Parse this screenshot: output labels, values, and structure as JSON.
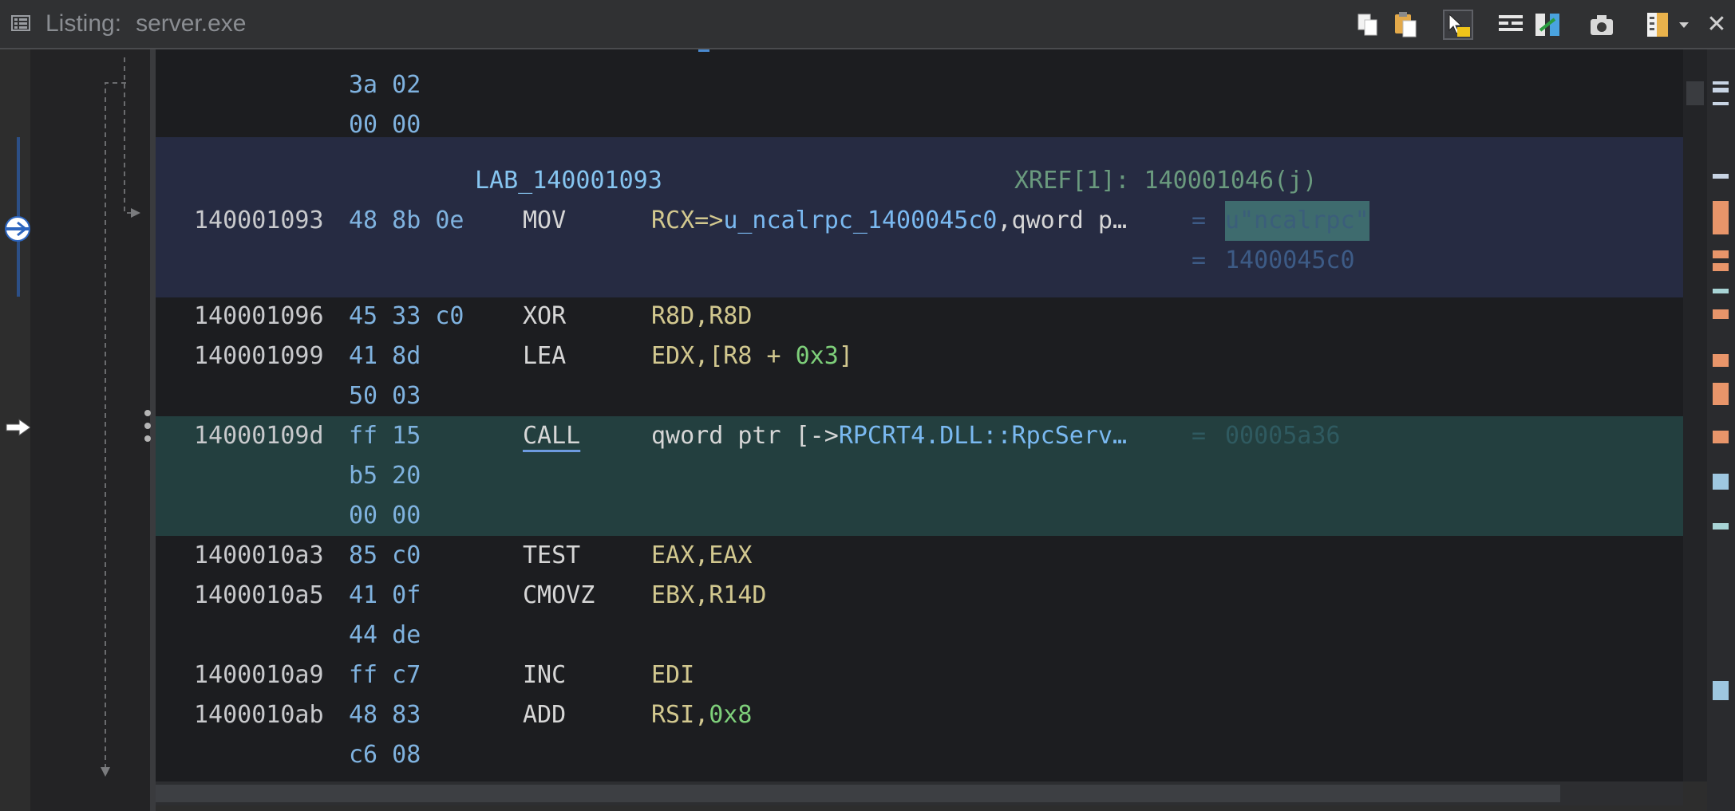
{
  "window": {
    "title_prefix": "Listing:",
    "title_file": "server.exe",
    "toolbar": [
      "copy-icon",
      "paste-icon",
      "cursor-highlight-icon",
      "field-config-icon",
      "diff-icon",
      "snapshot-icon",
      "display-options-icon",
      "dropdown-icon",
      "close-icon"
    ],
    "close_glyph": "✕"
  },
  "listing": {
    "rows": [
      {
        "bytes": "3a 02"
      },
      {
        "bytes": "00 00"
      },
      {
        "label": "LAB_140001093",
        "xref": "XREF[1]: 140001046(j)"
      },
      {
        "addr": "140001093",
        "bytes": "48 8b 0e",
        "mnemonic": "MOV",
        "op_pre": "RCX=>",
        "op_ref": "u_ncalrpc_1400045c0",
        "op_post": ",qword p…",
        "eq": " = ",
        "value": "u\"ncalrpc\""
      },
      {
        "eq": " = ",
        "value": "1400045c0"
      },
      {
        "addr": "140001096",
        "bytes": "45 33 c0",
        "mnemonic": "XOR",
        "operands": "R8D,R8D"
      },
      {
        "addr": "140001099",
        "bytes": "41 8d",
        "mnemonic": "LEA",
        "op_pre": "EDX,[R8 + ",
        "op_num": "0x3",
        "op_post": "]"
      },
      {
        "bytes": "50 03"
      },
      {
        "addr": "14000109d",
        "bytes": "ff 15",
        "mnemonic": "CALL",
        "op_pre": "qword ptr [->",
        "op_ref": "RPCRT4.DLL::RpcServ…",
        "eq": " = ",
        "value": "00005a36"
      },
      {
        "bytes": "b5 20"
      },
      {
        "bytes": "00 00"
      },
      {
        "addr": "1400010a3",
        "bytes": "85 c0",
        "mnemonic": "TEST",
        "operands": "EAX,EAX"
      },
      {
        "addr": "1400010a5",
        "bytes": "41 0f",
        "mnemonic": "CMOVZ",
        "operands": "EBX,R14D"
      },
      {
        "bytes": "44 de"
      },
      {
        "addr": "1400010a9",
        "bytes": "ff c7",
        "mnemonic": "INC",
        "operands": "EDI"
      },
      {
        "addr": "1400010ab",
        "bytes": "48 83",
        "mnemonic": "ADD",
        "op_pre": "RSI,",
        "op_num": "0x8"
      },
      {
        "bytes": "c6 08"
      }
    ]
  },
  "colors": {
    "background": "#1c1d20",
    "label_band": "#262b42",
    "call_band": "#233f3f",
    "address": "#c8c9cc",
    "bytes": "#7fb2df",
    "operands": "#d2c88f",
    "immediate": "#7ecf7a",
    "reference": "#7ab9f1",
    "xref": "#6a9a7e"
  }
}
